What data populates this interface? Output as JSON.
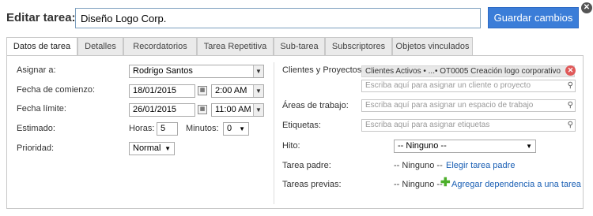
{
  "dialog": {
    "title_label": "Editar tarea:",
    "title_value": "Diseño Logo Corp.",
    "save_label": "Guardar cambios",
    "close_symbol": "✕"
  },
  "tabs": [
    {
      "label": "Datos de tarea",
      "active": true
    },
    {
      "label": "Detalles",
      "active": false
    },
    {
      "label": "Recordatorios",
      "active": false
    },
    {
      "label": "Tarea Repetitiva",
      "active": false
    },
    {
      "label": "Sub-tarea",
      "active": false
    },
    {
      "label": "Subscriptores",
      "active": false
    },
    {
      "label": "Objetos vinculados",
      "active": false
    }
  ],
  "left": {
    "assign_label": "Asignar a:",
    "assign_value": "Rodrigo Santos",
    "start_label": "Fecha de comienzo:",
    "start_date": "18/01/2015",
    "start_time": "2:00 AM",
    "due_label": "Fecha límite:",
    "due_date": "26/01/2015",
    "due_time": "11:00 AM",
    "estimate_label": "Estimado:",
    "hours_label": "Horas:",
    "hours_value": "5",
    "minutes_label": "Minutos:",
    "minutes_value": "0",
    "priority_label": "Prioridad:",
    "priority_value": "Normal"
  },
  "right": {
    "clients_label": "Clientes y Proyectos:",
    "client_chip": "Clientes Activos • ...• OT0005 Creación logo corporativo",
    "client_placeholder": "Escriba aquí para asignar un cliente o proyecto",
    "areas_label": "Áreas de trabajo:",
    "areas_placeholder": "Escriba aquí para asignar un espacio de trabajo",
    "tags_label": "Etiquetas:",
    "tags_placeholder": "Escriba aquí para asignar etiquetas",
    "milestone_label": "Hito:",
    "milestone_value": "-- Ninguno --",
    "parent_label": "Tarea padre:",
    "parent_value": "-- Ninguno --",
    "parent_link": "Elegir tarea padre",
    "prev_label": "Tareas previas:",
    "prev_value": "-- Ninguno --",
    "prev_link": "Agregar dependencia a una tarea"
  },
  "colors": {
    "save_button": "#3b7dd8",
    "link": "#1a5fb4",
    "remove_chip": "#e05a5a",
    "add_plus": "#4caf2b"
  }
}
